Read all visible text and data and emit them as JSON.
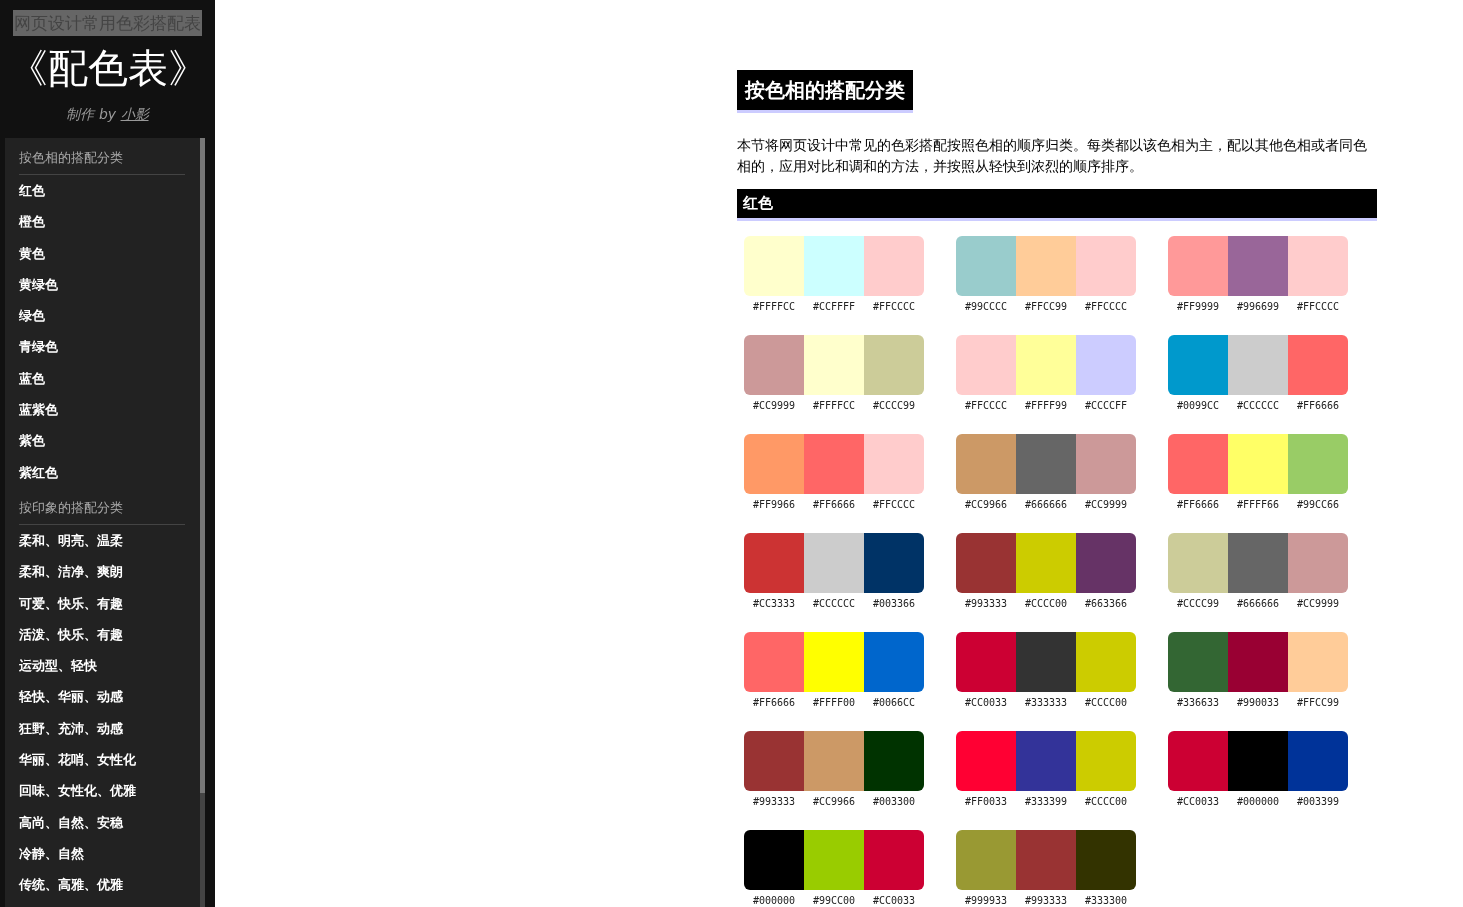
{
  "sidebar": {
    "site_label": "网页设计常用色彩搭配表",
    "title": "《配色表》",
    "credit_prefix": "制作 by",
    "credit_link": "小影",
    "groups": [
      {
        "title": "按色相的搭配分类",
        "items": [
          "红色",
          "橙色",
          "黄色",
          "黄绿色",
          "绿色",
          "青绿色",
          "蓝色",
          "蓝紫色",
          "紫色",
          "紫红色"
        ]
      },
      {
        "title": "按印象的搭配分类",
        "items": [
          "柔和、明亮、温柔",
          "柔和、洁净、爽朗",
          "可爱、快乐、有趣",
          "活泼、快乐、有趣",
          "运动型、轻快",
          "轻快、华丽、动感",
          "狂野、充沛、动感",
          "华丽、花哨、女性化",
          "回味、女性化、优雅",
          "高尚、自然、安稳",
          "冷静、自然",
          "传统、高雅、优雅"
        ]
      }
    ]
  },
  "main": {
    "heading": "按色相的搭配分类",
    "intro": "本节将网页设计中常见的色彩搭配按照色相的顺序归类。每类都以该色相为主，配以其他色相或者同色相的，应用对比和调和的方法，并按照从轻快到浓烈的顺序排序。",
    "section": {
      "title": "红色",
      "palettes": [
        [
          {
            "hex": "#FFFFCC",
            "color": "#ffffcc"
          },
          {
            "hex": "#CCFFFF",
            "color": "#ccffff"
          },
          {
            "hex": "#FFCCCC",
            "color": "#ffcccc"
          }
        ],
        [
          {
            "hex": "#99CCCC",
            "color": "#99cccc"
          },
          {
            "hex": "#FFCC99",
            "color": "#ffcc99"
          },
          {
            "hex": "#FFCCCC",
            "color": "#ffcccc"
          }
        ],
        [
          {
            "hex": "#FF9999",
            "color": "#ff9999"
          },
          {
            "hex": "#996699",
            "color": "#996699"
          },
          {
            "hex": "#FFCCCC",
            "color": "#ffcccc"
          }
        ],
        [
          {
            "hex": "#CC9999",
            "color": "#cc9999"
          },
          {
            "hex": "#FFFFCC",
            "color": "#ffffcc"
          },
          {
            "hex": "#CCCC99",
            "color": "#cccc99"
          }
        ],
        [
          {
            "hex": "#FFCCCC",
            "color": "#ffcccc"
          },
          {
            "hex": "#FFFF99",
            "color": "#ffff99"
          },
          {
            "hex": "#CCCCFF",
            "color": "#ccccff"
          }
        ],
        [
          {
            "hex": "#0099CC",
            "color": "#0099cc"
          },
          {
            "hex": "#CCCCCC",
            "color": "#cccccc"
          },
          {
            "hex": "#FF6666",
            "color": "#ff6666"
          }
        ],
        [
          {
            "hex": "#FF9966",
            "color": "#ff9966"
          },
          {
            "hex": "#FF6666",
            "color": "#ff6666"
          },
          {
            "hex": "#FFCCCC",
            "color": "#ffcccc"
          }
        ],
        [
          {
            "hex": "#CC9966",
            "color": "#cc9966"
          },
          {
            "hex": "#666666",
            "color": "#666666"
          },
          {
            "hex": "#CC9999",
            "color": "#cc9999"
          }
        ],
        [
          {
            "hex": "#FF6666",
            "color": "#ff6666"
          },
          {
            "hex": "#FFFF66",
            "color": "#ffff66"
          },
          {
            "hex": "#99CC66",
            "color": "#99cc66"
          }
        ],
        [
          {
            "hex": "#CC3333",
            "color": "#cc3333"
          },
          {
            "hex": "#CCCCCC",
            "color": "#cccccc"
          },
          {
            "hex": "#003366",
            "color": "#003366"
          }
        ],
        [
          {
            "hex": "#993333",
            "color": "#993333"
          },
          {
            "hex": "#CCCC00",
            "color": "#cccc00"
          },
          {
            "hex": "#663366",
            "color": "#663366"
          }
        ],
        [
          {
            "hex": "#CCCC99",
            "color": "#cccc99"
          },
          {
            "hex": "#666666",
            "color": "#666666"
          },
          {
            "hex": "#CC9999",
            "color": "#cc9999"
          }
        ],
        [
          {
            "hex": "#FF6666",
            "color": "#ff6666"
          },
          {
            "hex": "#FFFF00",
            "color": "#ffff00"
          },
          {
            "hex": "#0066CC",
            "color": "#0066cc"
          }
        ],
        [
          {
            "hex": "#CC0033",
            "color": "#cc0033"
          },
          {
            "hex": "#333333",
            "color": "#333333"
          },
          {
            "hex": "#CCCC00",
            "color": "#cccc00"
          }
        ],
        [
          {
            "hex": "#336633",
            "color": "#336633"
          },
          {
            "hex": "#990033",
            "color": "#990033"
          },
          {
            "hex": "#FFCC99",
            "color": "#ffcc99"
          }
        ],
        [
          {
            "hex": "#993333",
            "color": "#993333"
          },
          {
            "hex": "#CC9966",
            "color": "#cc9966"
          },
          {
            "hex": "#003300",
            "color": "#003300"
          }
        ],
        [
          {
            "hex": "#FF0033",
            "color": "#ff0033"
          },
          {
            "hex": "#333399",
            "color": "#333399"
          },
          {
            "hex": "#CCCC00",
            "color": "#cccc00"
          }
        ],
        [
          {
            "hex": "#CC0033",
            "color": "#cc0033"
          },
          {
            "hex": "#000000",
            "color": "#000000"
          },
          {
            "hex": "#003399",
            "color": "#003399"
          }
        ],
        [
          {
            "hex": "#000000",
            "color": "#000000"
          },
          {
            "hex": "#99CC00",
            "color": "#99cc00"
          },
          {
            "hex": "#CC0033",
            "color": "#cc0033"
          }
        ],
        [
          {
            "hex": "#999933",
            "color": "#999933"
          },
          {
            "hex": "#993333",
            "color": "#993333"
          },
          {
            "hex": "#333300",
            "color": "#333300"
          }
        ]
      ]
    }
  }
}
